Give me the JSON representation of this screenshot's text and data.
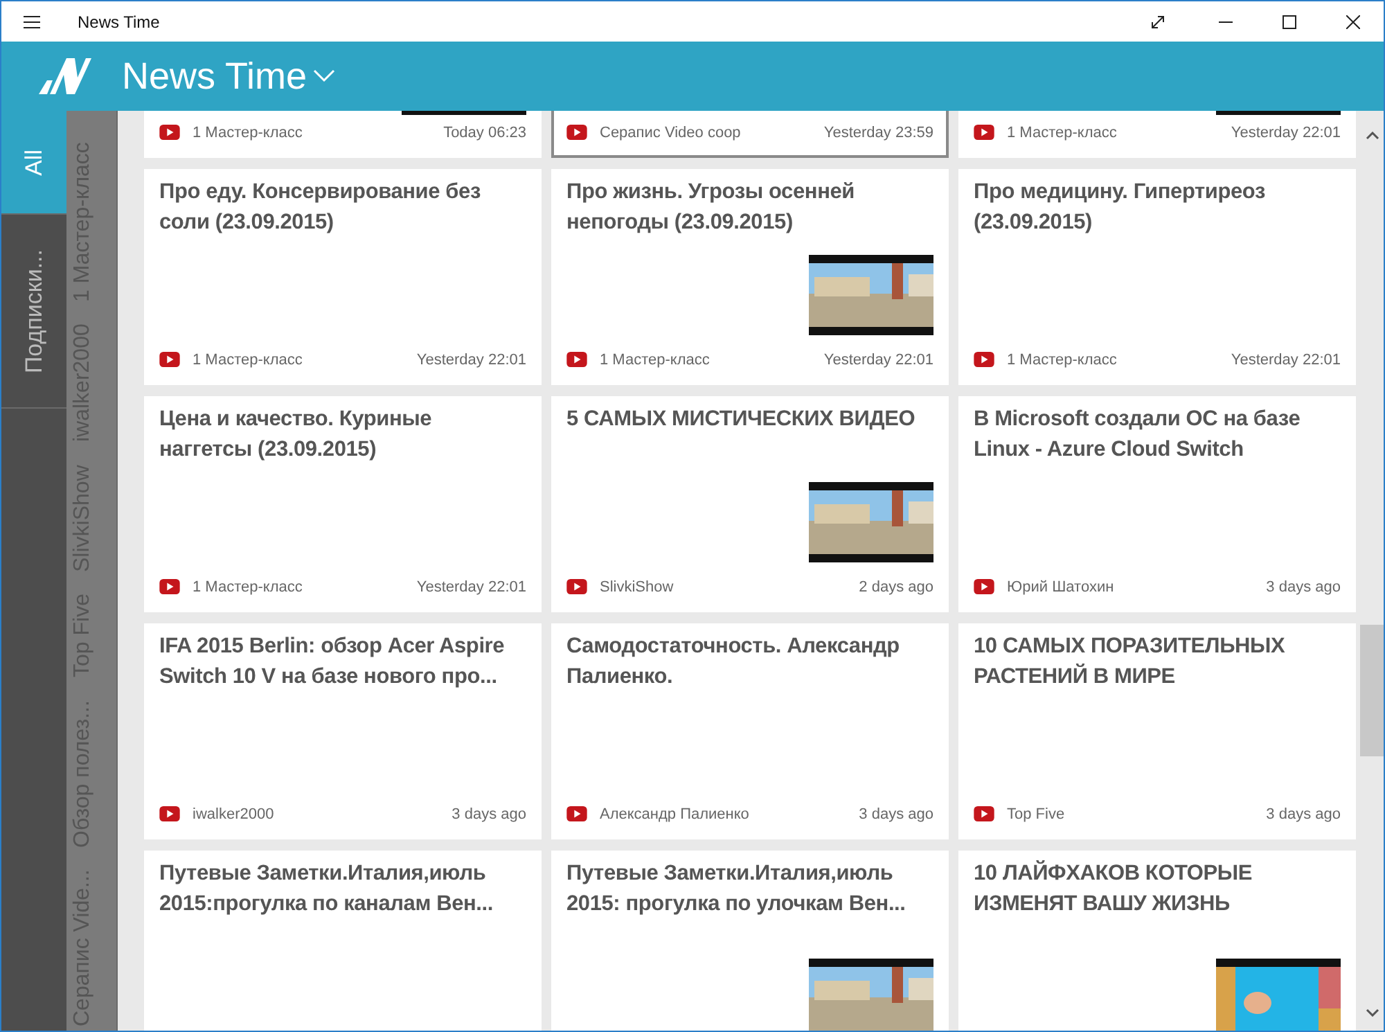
{
  "window": {
    "title": "News Time"
  },
  "header": {
    "title": "News Time"
  },
  "tabs": [
    {
      "label": "All",
      "selected": true
    },
    {
      "label": "Подписки...",
      "selected": false
    }
  ],
  "sources": [
    "Серапис Vide...",
    "Обзор полез...",
    "Top Five",
    "SlivkiShow",
    "iwalker2000",
    "1 Мастер-класс"
  ],
  "cards": [
    {
      "source": "1 Мастер-класс",
      "time": "Today 06:23",
      "thumbnail": true,
      "selected": false
    },
    {
      "source": "Серапис Video coop",
      "time": "Yesterday 23:59",
      "thumbnail": false,
      "selected": true
    },
    {
      "source": "1 Мастер-класс",
      "time": "Yesterday 22:01",
      "thumbnail": true,
      "selected": false
    },
    {
      "title": "Про еду. Консервирование без соли (23.09.2015)",
      "source": "1 Мастер-класс",
      "time": "Yesterday 22:01",
      "thumbnail": false,
      "selected": false
    },
    {
      "title": "Про жизнь. Угрозы осенней непогоды (23.09.2015)",
      "source": "1 Мастер-класс",
      "time": "Yesterday 22:01",
      "thumbnail": true,
      "selected": false
    },
    {
      "title": "Про медицину. Гипертиреоз (23.09.2015)",
      "source": "1 Мастер-класс",
      "time": "Yesterday 22:01",
      "thumbnail": false,
      "selected": false
    },
    {
      "title": "Цена и качество. Куриные наггетсы (23.09.2015)",
      "source": "1 Мастер-класс",
      "time": "Yesterday 22:01",
      "thumbnail": false,
      "selected": false
    },
    {
      "title": "5 САМЫХ МИСТИЧЕСКИХ ВИДЕО",
      "source": "SlivkiShow",
      "time": "2 days ago",
      "thumbnail": true,
      "selected": false
    },
    {
      "title": "В Microsoft создали ОС на базе Linux - Azure Cloud Switch",
      "source": "Юрий Шатохин",
      "time": "3 days ago",
      "thumbnail": false,
      "selected": false
    },
    {
      "title": "IFA 2015 Berlin: обзор Acer Aspire Switch 10 V на базе нового про...",
      "source": "iwalker2000",
      "time": "3 days ago",
      "thumbnail": false,
      "selected": false
    },
    {
      "title": "Самодостаточность. Александр Палиенко.",
      "source": "Александр Палиенко",
      "time": "3 days ago",
      "thumbnail": false,
      "selected": false
    },
    {
      "title": "10 САМЫХ ПОРАЗИТЕЛЬНЫХ РАСТЕНИЙ В МИРЕ",
      "source": "Top Five",
      "time": "3 days ago",
      "thumbnail": false,
      "selected": false
    },
    {
      "title": "Путевые Заметки.Италия,июль 2015:прогулка по каналам Вен...",
      "thumbnail": false,
      "selected": false
    },
    {
      "title": "Путевые Заметки.Италия,июль 2015: прогулка по улочкам Вен...",
      "thumbnail": true,
      "selected": false
    },
    {
      "title": "10 ЛАЙФХАКОВ КОТОРЫЕ ИЗМЕНЯТ ВАШУ ЖИЗНЬ",
      "thumbnail": true,
      "selected": false
    }
  ]
}
